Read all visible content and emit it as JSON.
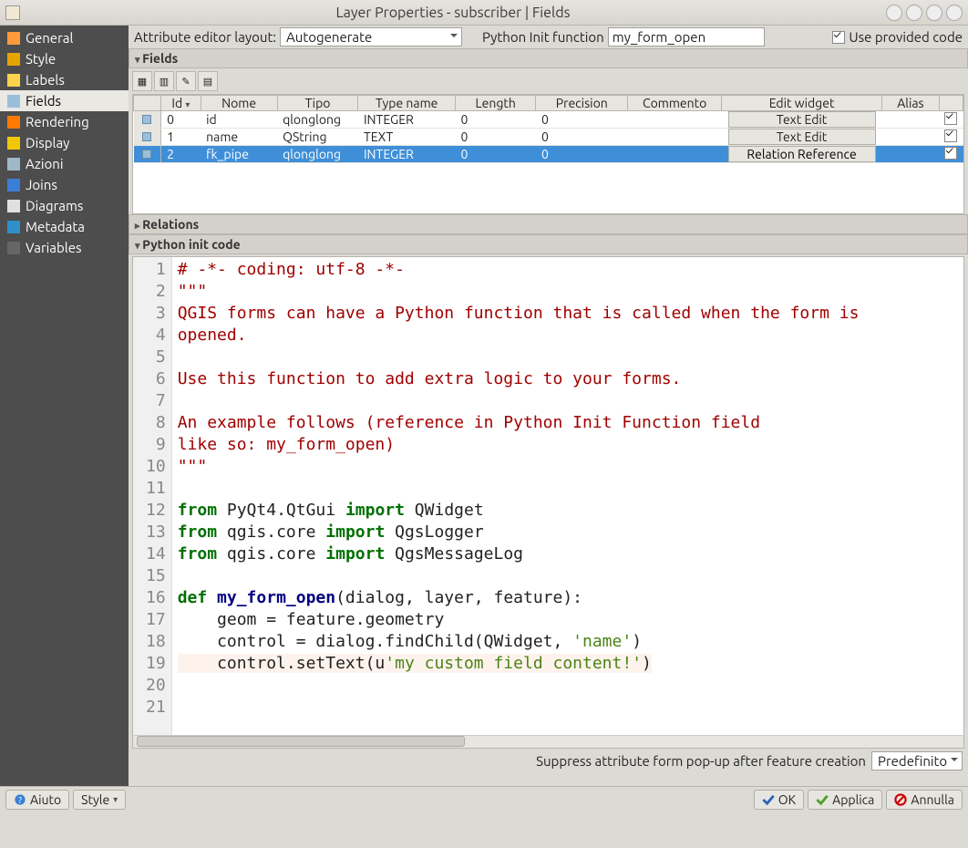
{
  "window": {
    "title": "Layer Properties - subscriber | Fields"
  },
  "sidebar": {
    "items": [
      {
        "label": "General",
        "icon": "#ff9a3c",
        "selected": false
      },
      {
        "label": "Style",
        "icon": "#e6a400",
        "selected": false
      },
      {
        "label": "Labels",
        "icon": "#ffd24d",
        "selected": false
      },
      {
        "label": "Fields",
        "icon": "#9bbedb",
        "selected": true
      },
      {
        "label": "Rendering",
        "icon": "#ff7a00",
        "selected": false
      },
      {
        "label": "Display",
        "icon": "#f0c800",
        "selected": false
      },
      {
        "label": "Azioni",
        "icon": "#9eb8c8",
        "selected": false
      },
      {
        "label": "Joins",
        "icon": "#3a7fd6",
        "selected": false
      },
      {
        "label": "Diagrams",
        "icon": "#e0e0e0",
        "selected": false
      },
      {
        "label": "Metadata",
        "icon": "#2e90c8",
        "selected": false
      },
      {
        "label": "Variables",
        "icon": "#666",
        "selected": false
      }
    ]
  },
  "toprow": {
    "attr_editor_layout_label": "Attribute editor layout:",
    "attr_editor_layout_value": "Autogenerate",
    "python_init_label": "Python Init function",
    "python_init_value": "my_form_open",
    "use_provided_code_label": "Use provided code",
    "use_provided_code_checked": true
  },
  "panels": {
    "fields_label": "Fields",
    "relations_label": "Relations",
    "python_init_label": "Python init code"
  },
  "fields_table": {
    "headers": [
      "Id",
      "Nome",
      "Tipo",
      "Type name",
      "Length",
      "Precision",
      "Commento",
      "Edit widget",
      "Alias",
      ""
    ],
    "rows": [
      {
        "id": "0",
        "nome": "id",
        "tipo": "qlonglong",
        "type_name": "INTEGER",
        "length": "0",
        "precision": "0",
        "commento": "",
        "edit_widget": "Text Edit",
        "alias": "",
        "checked": true,
        "selected": false
      },
      {
        "id": "1",
        "nome": "name",
        "tipo": "QString",
        "type_name": "TEXT",
        "length": "0",
        "precision": "0",
        "commento": "",
        "edit_widget": "Text Edit",
        "alias": "",
        "checked": true,
        "selected": false
      },
      {
        "id": "2",
        "nome": "fk_pipe",
        "tipo": "qlonglong",
        "type_name": "INTEGER",
        "length": "0",
        "precision": "0",
        "commento": "",
        "edit_widget": "Relation Reference",
        "alias": "",
        "checked": true,
        "selected": true
      }
    ]
  },
  "code": {
    "lines": [
      {
        "n": 1,
        "t": "# -*- coding: utf-8 -*-",
        "cls": "c-comment"
      },
      {
        "n": 2,
        "t": "\"\"\"",
        "cls": "c-comment"
      },
      {
        "n": 3,
        "t": "QGIS forms can have a Python function that is called when the form is",
        "cls": "c-comment"
      },
      {
        "n": 4,
        "t": "opened.",
        "cls": "c-comment"
      },
      {
        "n": 5,
        "t": "",
        "cls": ""
      },
      {
        "n": 6,
        "t": "Use this function to add extra logic to your forms.",
        "cls": "c-comment"
      },
      {
        "n": 7,
        "t": "",
        "cls": ""
      },
      {
        "n": 8,
        "t": "An example follows (reference in Python Init Function field",
        "cls": "c-comment"
      },
      {
        "n": 9,
        "t": "like so: my_form_open)",
        "cls": "c-comment"
      },
      {
        "n": 10,
        "t": "\"\"\"",
        "cls": "c-comment"
      },
      {
        "n": 11,
        "t": "",
        "cls": ""
      }
    ],
    "rich_lines": {
      "12": [
        {
          "t": "from",
          "c": "c-kw"
        },
        {
          "t": " PyQt4.QtGui "
        },
        {
          "t": "import",
          "c": "c-kw"
        },
        {
          "t": " QWidget"
        }
      ],
      "13": [
        {
          "t": "from",
          "c": "c-kw"
        },
        {
          "t": " qgis.core "
        },
        {
          "t": "import",
          "c": "c-kw"
        },
        {
          "t": " QgsLogger"
        }
      ],
      "14": [
        {
          "t": "from",
          "c": "c-kw"
        },
        {
          "t": " qgis.core "
        },
        {
          "t": "import",
          "c": "c-kw"
        },
        {
          "t": " QgsMessageLog"
        }
      ],
      "15": [
        {
          "t": ""
        }
      ],
      "16": [
        {
          "t": "def ",
          "c": "c-kw"
        },
        {
          "t": "my_form_open",
          "c": "c-def"
        },
        {
          "t": "(dialog, layer, feature):"
        }
      ],
      "17": [
        {
          "t": "    geom = feature.geometry"
        }
      ],
      "18": [
        {
          "t": "    control = dialog.findChild(QWidget, "
        },
        {
          "t": "'name'",
          "c": "c-str"
        },
        {
          "t": ")"
        }
      ],
      "19": [
        {
          "t": "    control.setText(u",
          "hl": true
        },
        {
          "t": "'my custom field content!'",
          "c": "c-str",
          "hl": true
        },
        {
          "t": ")",
          "hl": true
        }
      ],
      "20": [
        {
          "t": ""
        }
      ],
      "21": [
        {
          "t": ""
        }
      ]
    }
  },
  "suppress_row": {
    "label": "Suppress attribute form pop-up after feature creation",
    "value": "Predefinito"
  },
  "footer": {
    "help": "Aiuto",
    "style": "Style",
    "ok": "OK",
    "apply": "Applica",
    "cancel": "Annulla"
  }
}
